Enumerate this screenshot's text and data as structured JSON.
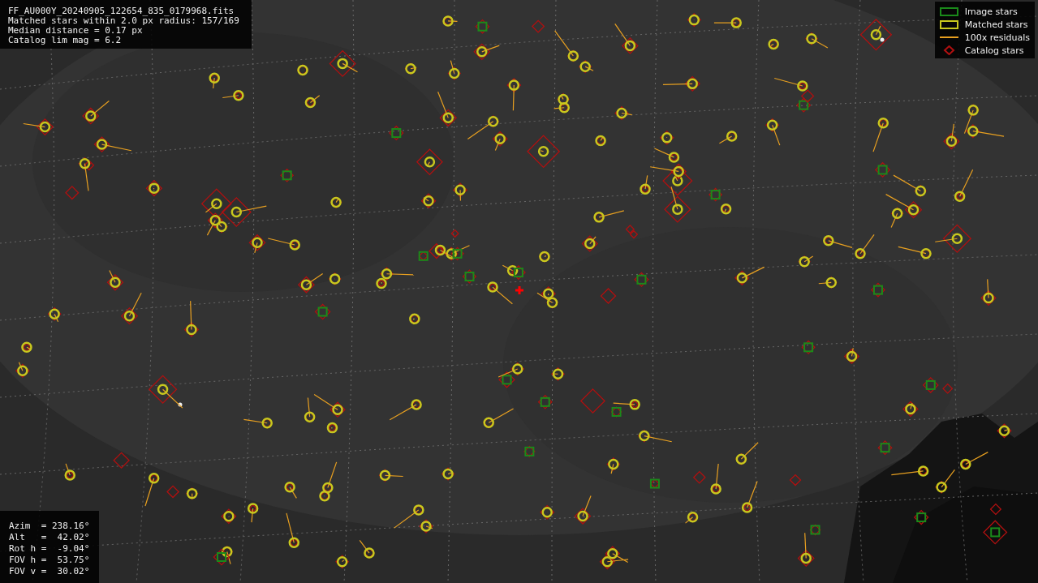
{
  "info": {
    "lines": [
      "FF_AU000Y_20240905_122654_835_0179968.fits",
      "Matched stars within 2.0 px radius: 157/169",
      "Median distance = 0.17 px",
      "Catalog lim mag = 6.2"
    ]
  },
  "legend": [
    {
      "kind": "box",
      "label": "Image stars",
      "color": "#1a8a1a"
    },
    {
      "kind": "box",
      "label": "Matched stars",
      "color": "#c8c81e"
    },
    {
      "kind": "line",
      "label": "100x residuals",
      "color": "#e8a020"
    },
    {
      "kind": "diamond",
      "label": "Catalog stars",
      "color": "#b01010"
    }
  ],
  "pointing": {
    "lines": [
      "Azim  = 238.16°",
      "Alt   =  42.02°",
      "Rot h =  -9.04°",
      "FOV h =  53.75°",
      "FOV v =  30.02°"
    ]
  }
}
